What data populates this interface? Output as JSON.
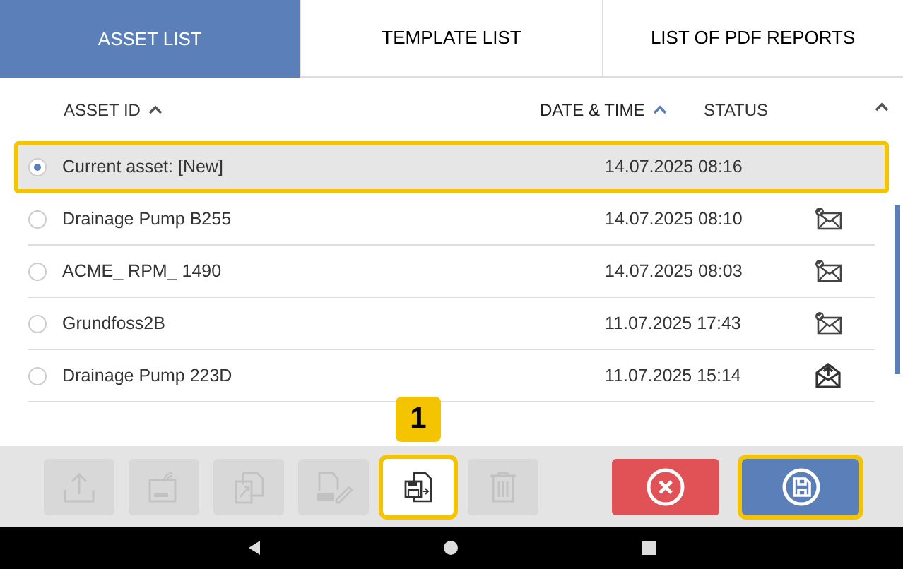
{
  "tabs": [
    {
      "label": "ASSET LIST",
      "selected": true
    },
    {
      "label": "TEMPLATE LIST",
      "selected": false
    },
    {
      "label": "LIST OF PDF REPORTS",
      "selected": false
    }
  ],
  "table": {
    "columns": [
      {
        "label": "ASSET ID",
        "sorted": true,
        "active": false
      },
      {
        "label": "DATE & TIME",
        "sorted": true,
        "active": true
      },
      {
        "label": "STATUS",
        "sorted": false,
        "active": false
      }
    ],
    "rows": [
      {
        "asset_id": "Current asset: [New]",
        "date_time": "14.07.2025 08:16",
        "kind": "none",
        "selected": true,
        "highlighted": true
      },
      {
        "asset_id": "Drainage Pump B255",
        "date_time": "14.07.2025 08:10",
        "kind": "sent",
        "selected": false,
        "highlighted": false
      },
      {
        "asset_id": "ACME_ RPM_ 1490",
        "date_time": "14.07.2025 08:03",
        "kind": "sent",
        "selected": false,
        "highlighted": false
      },
      {
        "asset_id": "Grundfoss2B",
        "date_time": "11.07.2025 17:43",
        "kind": "sent",
        "selected": false,
        "highlighted": false
      },
      {
        "asset_id": "Drainage Pump 223D",
        "date_time": "11.07.2025 15:14",
        "kind": "outbox",
        "selected": false,
        "highlighted": false
      }
    ]
  },
  "toolbar": [
    {
      "kind": "upload",
      "disabled": true,
      "highlighted": false
    },
    {
      "kind": "rfid",
      "disabled": true,
      "highlighted": false
    },
    {
      "kind": "export",
      "disabled": true,
      "highlighted": false
    },
    {
      "kind": "nameplate",
      "disabled": true,
      "highlighted": false
    },
    {
      "kind": "copy",
      "disabled": false,
      "highlighted": true,
      "callout": "1"
    },
    {
      "kind": "delete",
      "disabled": true,
      "highlighted": false
    }
  ],
  "actions": [
    {
      "kind": "cancel",
      "highlighted": false
    },
    {
      "kind": "save",
      "highlighted": true
    }
  ],
  "nav_bar": [
    {
      "kind": "back"
    },
    {
      "kind": "home"
    },
    {
      "kind": "recents"
    }
  ]
}
